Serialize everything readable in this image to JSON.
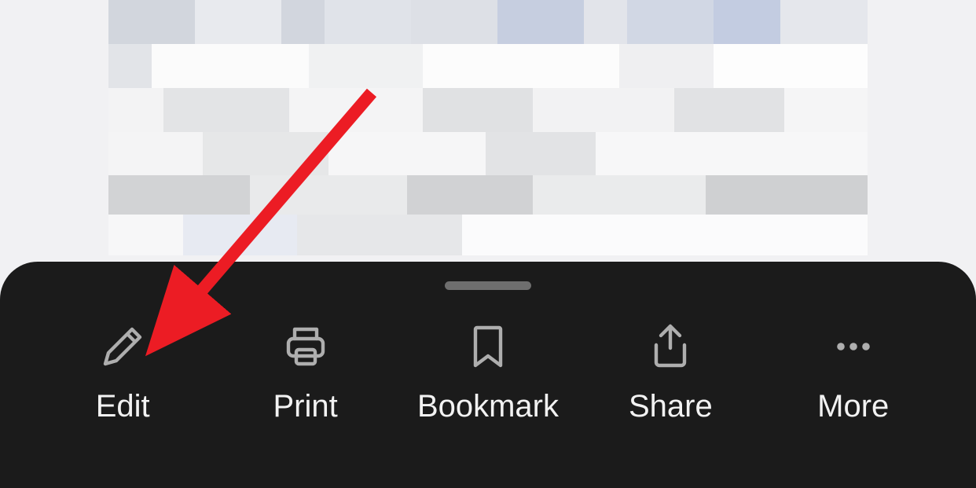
{
  "toolbar": {
    "items": [
      {
        "id": "edit",
        "label": "Edit",
        "icon": "pencil-icon"
      },
      {
        "id": "print",
        "label": "Print",
        "icon": "printer-icon"
      },
      {
        "id": "bookmark",
        "label": "Bookmark",
        "icon": "bookmark-icon"
      },
      {
        "id": "share",
        "label": "Share",
        "icon": "share-icon"
      },
      {
        "id": "more",
        "label": "More",
        "icon": "dots-icon"
      }
    ]
  },
  "annotation": {
    "type": "arrow",
    "color": "#ec1c24",
    "target": "edit"
  }
}
